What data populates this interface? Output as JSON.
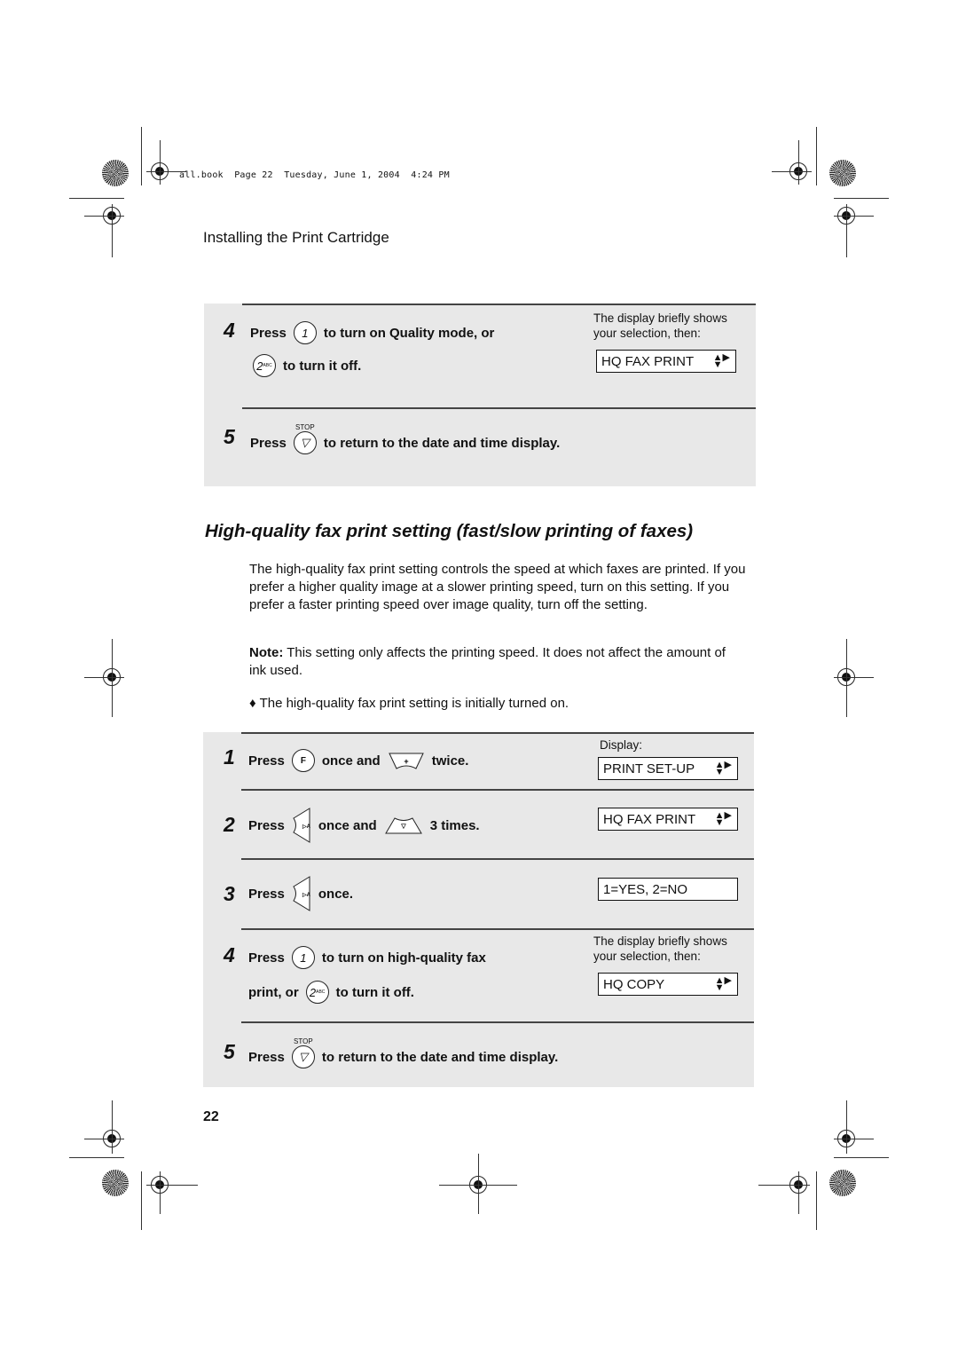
{
  "header": {
    "meta": "all.book  Page 22  Tuesday, June 1, 2004  4:24 PM",
    "section": "Installing the Print Cartridge"
  },
  "box1": {
    "step4": {
      "num": "4",
      "press": "Press",
      "key1": "1",
      "text1": "to turn on Quality mode, or",
      "key2": "2",
      "key2_sub": "ABC",
      "text2": "to turn it off.",
      "note": "The display briefly shows your selection, then:",
      "display": "HQ FAX PRINT"
    },
    "step5": {
      "num": "5",
      "press": "Press",
      "stop_label": "STOP",
      "text": "to return to the date and time display."
    }
  },
  "heading": "High-quality fax print setting (fast/slow printing of faxes)",
  "body": {
    "p1": "The high-quality fax print setting controls the speed at which faxes are printed. If you prefer a higher quality image at a slower printing speed, turn on this setting. If you prefer a faster printing speed over image quality, turn off the setting.",
    "note_label": "Note:",
    "note_text": " This setting only affects the printing speed. It does not affect the amount of ink used.",
    "bullet": "The high-quality fax print setting is initially turned on."
  },
  "box2": {
    "display_label": "Display:",
    "step1": {
      "num": "1",
      "press": "Press",
      "key": "F",
      "mid": "once and",
      "end": "twice.",
      "display": "PRINT SET-UP"
    },
    "step2": {
      "num": "2",
      "press": "Press",
      "mid": "once and",
      "end": "3 times.",
      "display": "HQ FAX PRINT"
    },
    "step3": {
      "num": "3",
      "press": "Press",
      "end": "once.",
      "display": "1=YES, 2=NO"
    },
    "step4": {
      "num": "4",
      "press": "Press",
      "key1": "1",
      "text1": "to turn on high-quality fax",
      "text2a": "print, or",
      "key2": "2",
      "key2_sub": "ABC",
      "text2b": "to turn it off.",
      "note": "The display briefly shows your selection, then:",
      "display": "HQ COPY"
    },
    "step5": {
      "num": "5",
      "press": "Press",
      "stop_label": "STOP",
      "text": "to return to the date and time display."
    }
  },
  "page_number": "22"
}
